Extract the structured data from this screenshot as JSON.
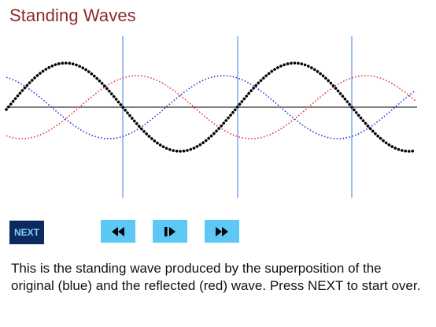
{
  "title": "Standing Waves",
  "buttons": {
    "next_label": "NEXT",
    "rewind_icon": "rewind-icon",
    "step_icon": "step-forward-icon",
    "forward_icon": "fast-forward-icon"
  },
  "description": "This is the standing wave produced by the superposition of the original (blue) and the reflected (red) wave.  Press NEXT to start over.",
  "colors": {
    "title": "#8b2a2a",
    "original_wave": "#2a2ad8",
    "reflected_wave": "#e03030",
    "standing_wave": "#000000",
    "node_lines": "#3a7fe0",
    "button_bg": "#5ec8f5",
    "next_bg": "#0d2a5e",
    "next_text": "#7fd1ff"
  }
}
